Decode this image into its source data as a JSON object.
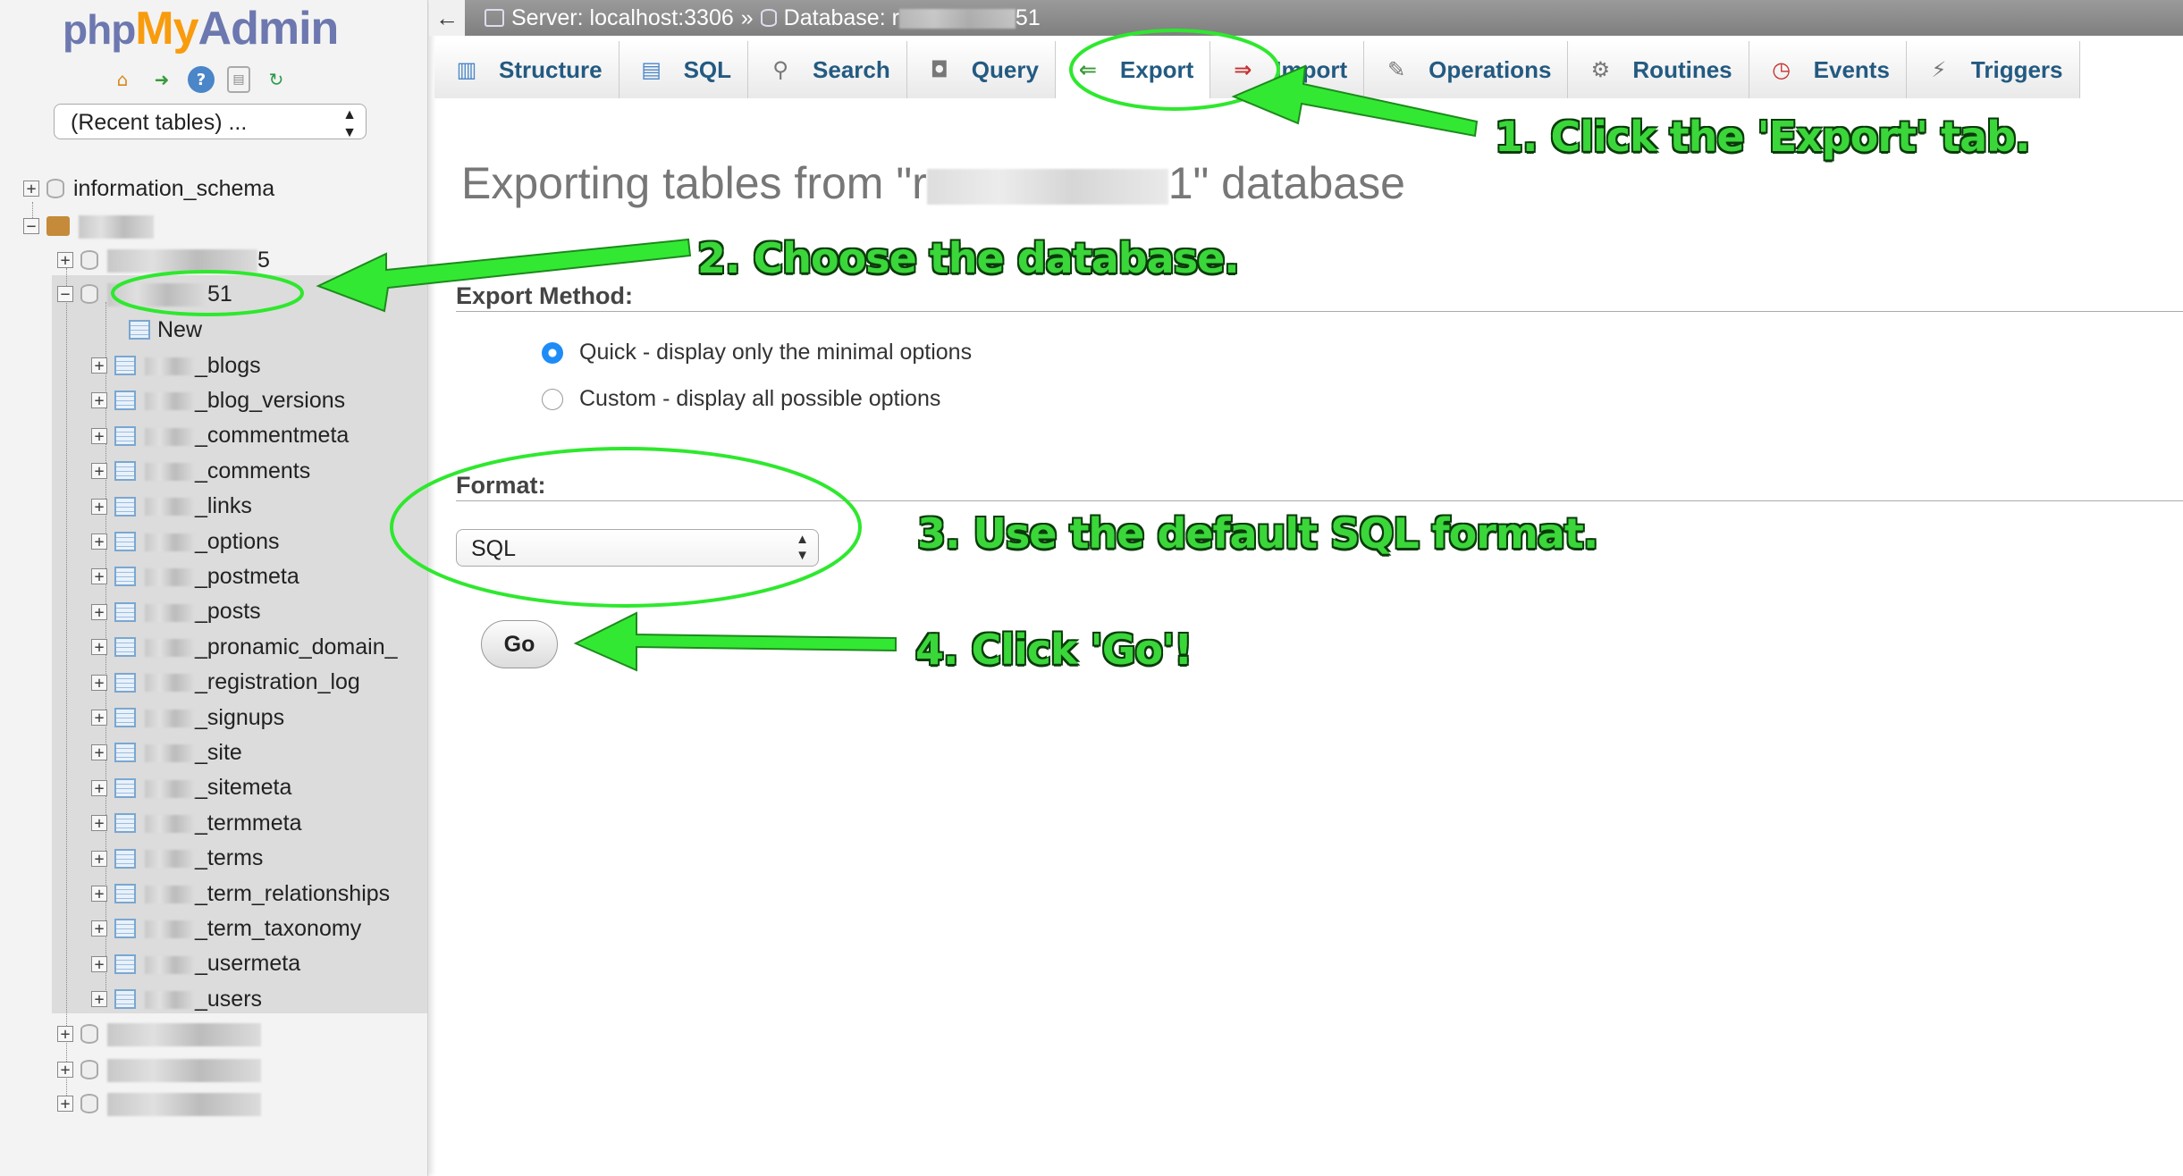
{
  "logo": {
    "php": "php",
    "my": "My",
    "admin": "Admin"
  },
  "sidebar": {
    "recent_tables": "(Recent tables) ...",
    "tree": {
      "information_schema": "information_schema",
      "db_suffix_1": "5",
      "selected_db_suffix": "51",
      "new_label": "New",
      "tables": [
        "_blogs",
        "_blog_versions",
        "_commentmeta",
        "_comments",
        "_links",
        "_options",
        "_postmeta",
        "_posts",
        "_pronamic_domain_",
        "_registration_log",
        "_signups",
        "_site",
        "_sitemeta",
        "_termmeta",
        "_terms",
        "_term_relationships",
        "_term_taxonomy",
        "_usermeta",
        "_users"
      ]
    }
  },
  "topbar": {
    "back": "←",
    "server": "Server: localhost:3306",
    "separator": "»",
    "database_prefix": "Database: r",
    "database_suffix": "51"
  },
  "tabs": [
    {
      "label": "Structure",
      "icon": "structure-icon"
    },
    {
      "label": "SQL",
      "icon": "sql-icon"
    },
    {
      "label": "Search",
      "icon": "search-icon"
    },
    {
      "label": "Query",
      "icon": "query-icon"
    },
    {
      "label": "Export",
      "icon": "export-icon"
    },
    {
      "label": "Import",
      "icon": "import-icon"
    },
    {
      "label": "Operations",
      "icon": "wrench-icon"
    },
    {
      "label": "Routines",
      "icon": "routines-icon"
    },
    {
      "label": "Events",
      "icon": "clock-icon"
    },
    {
      "label": "Triggers",
      "icon": "triggers-icon"
    }
  ],
  "main": {
    "title_prefix": "Exporting tables from \"r",
    "title_suffix": "1\" database",
    "export_method_title": "Export Method:",
    "quick_option": "Quick - display only the minimal options",
    "custom_option": "Custom - display all possible options",
    "format_title": "Format:",
    "format_value": "SQL",
    "go_button": "Go"
  },
  "annotations": {
    "step1": "1. Click the 'Export' tab.",
    "step2": "2. Choose the database.",
    "step3": "3. Use the default SQL format.",
    "step4": "4. Click 'Go'!"
  },
  "colors": {
    "annotation_green": "#3ad63a",
    "link_blue": "#235a81",
    "radio_blue": "#1e8cf7"
  }
}
